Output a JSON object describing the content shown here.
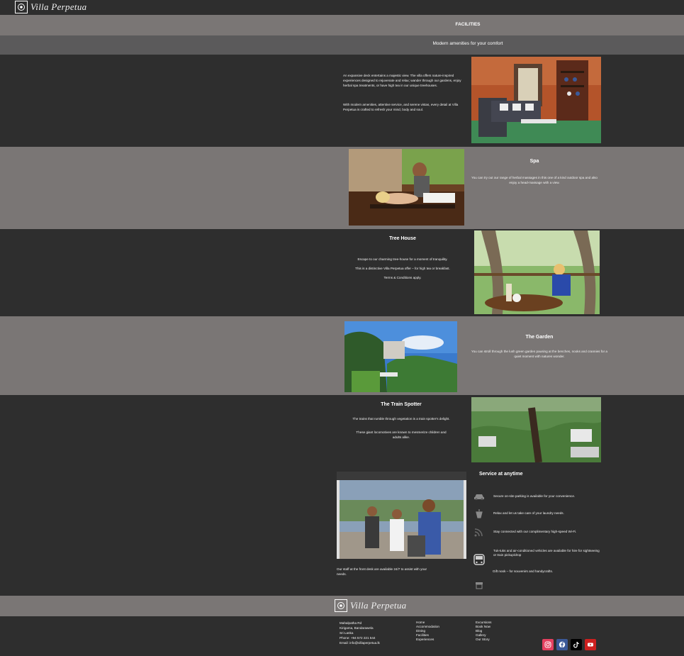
{
  "header": {
    "logo_text": "Villa Perpetua"
  },
  "page": {
    "title": "FACILITIES",
    "subtitle": "Modern amenities for your comfort"
  },
  "intro": {
    "para1": "An expansive deck entertains a majestic view. The villa offers nature-inspired experiences designed to rejuvenate and relax; wander through our gardens, enjoy herbal spa treatments, or have high tea in our unique treehouses.",
    "para2": "With modern amenities, attentive service, and serene vistas, every detail at Villa Perpetua is crafted to refresh your mind, body and soul."
  },
  "spa": {
    "title": "Spa",
    "text": "You can try out our range of herbal massages in this one of a kind outdoor spa and also enjoy a head-massage with a view."
  },
  "treehouse": {
    "title": "Tree House",
    "line1": "Escape to our charming tree-house for a moment of tranquility.",
    "line2": "This is a distinctive Villa Perpetua offer – for high tea or breakfast.",
    "line3": "Terms & Conditions apply."
  },
  "garden": {
    "title": "The Garden",
    "text": "You can stroll through the lush  green garden pausing at the benches, nooks and crannies for a quiet moment with natures wonder."
  },
  "train": {
    "title": "The Train Spotter",
    "line1": "The trains that rumble through vegetation is a train spotter's delight.",
    "line2": "These giant locomotives are known to mesmerize children and adults alike."
  },
  "service": {
    "title": "Service at anytime",
    "staff_text": "Our staff at the front desk are available 24/7 to assist with your needs.",
    "items": [
      {
        "icon": "car-icon",
        "text": "Secure on-site parking is available for your convenience."
      },
      {
        "icon": "laundry-icon",
        "text": "Relax and let us take care of your laundry needs."
      },
      {
        "icon": "wifi-icon",
        "text": "Stay connected with our complimentary high-speed Wi-Fi."
      },
      {
        "icon": "bus-icon",
        "text": "Tuk-tuks and air-conditioned vehicles are available for hire for sightseeing or train pickup/drop"
      },
      {
        "icon": "shop-icon",
        "text": "Gift nook – for souvenirs and handycrafts."
      }
    ]
  },
  "footer": {
    "logo_text": "Villa Perpetua",
    "address": [
      "Mahalpatha Rd",
      "Kirigama, Bandarawela",
      "Sri Lanka"
    ],
    "phone_label": "Phone:",
    "phone": "+94 572 221 544",
    "email_label": "Email:",
    "email": "info@villaperpetua.lk",
    "links1": [
      "Home",
      "Accommodation",
      "Dining",
      "Facilities",
      "Experiences"
    ],
    "links2": [
      "Excursions",
      "Book Now",
      "Blog",
      "Gallery",
      "Our Story"
    ],
    "social": [
      {
        "icon": "instagram-icon",
        "color": "#e4405f"
      },
      {
        "icon": "facebook-icon",
        "color": "#3b5998"
      },
      {
        "icon": "tiktok-icon",
        "color": "#000000"
      },
      {
        "icon": "youtube-icon",
        "color": "#cd201f"
      }
    ]
  },
  "colors": {
    "dark_band": "#2e2e2e",
    "light_band": "#7a7675",
    "subtitle_band": "#5b5a5b"
  }
}
